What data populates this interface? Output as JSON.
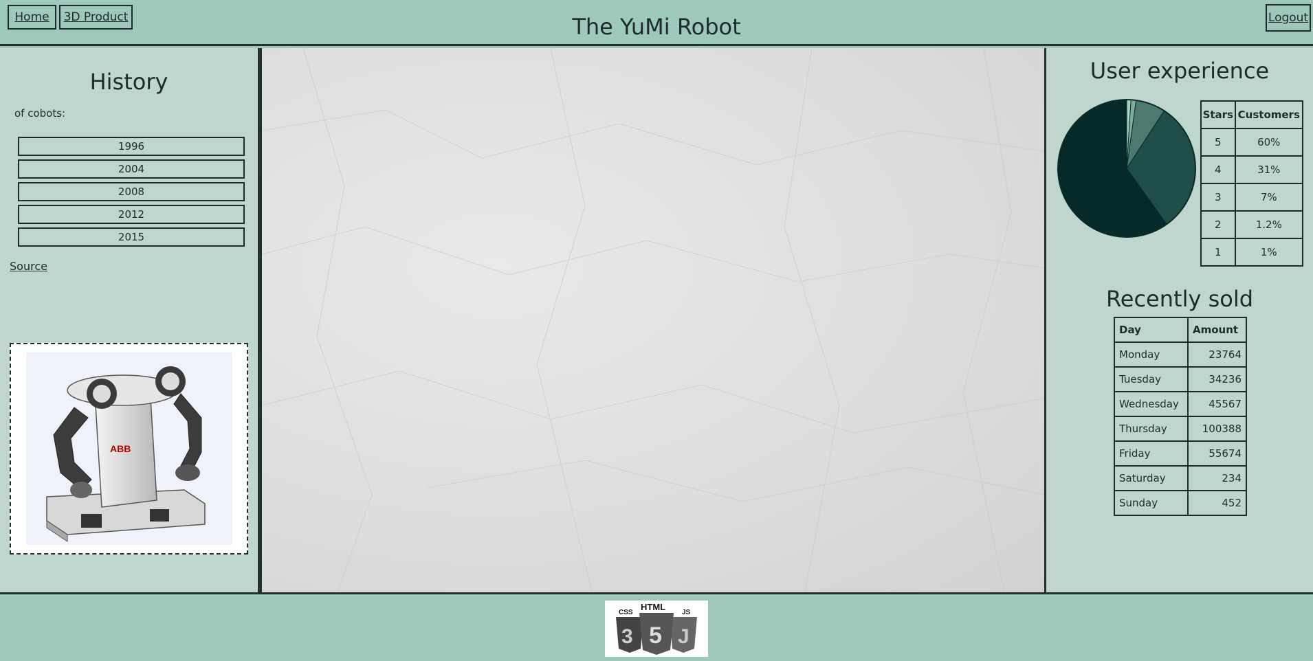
{
  "header": {
    "title": "The YuMi Robot",
    "nav": {
      "home": "Home",
      "product": "3D Product",
      "logout": "Logout"
    }
  },
  "history": {
    "title": "History",
    "subtitle": "of cobots:",
    "years": [
      "1996",
      "2004",
      "2008",
      "2012",
      "2015"
    ],
    "source_label": "Source",
    "image_icon": "yumi-robot-image",
    "robot_brand": "ABB"
  },
  "user_experience": {
    "title": "User experience",
    "headers": {
      "stars": "Stars",
      "customers": "Customers"
    },
    "rows": [
      {
        "stars": "5",
        "customers": "60%"
      },
      {
        "stars": "4",
        "customers": "31%"
      },
      {
        "stars": "3",
        "customers": "7%"
      },
      {
        "stars": "2",
        "customers": "1.2%"
      },
      {
        "stars": "1",
        "customers": "1%"
      }
    ]
  },
  "chart_data": {
    "type": "pie",
    "categories": [
      "5",
      "4",
      "3",
      "2",
      "1"
    ],
    "values": [
      60,
      31,
      7,
      1.2,
      1
    ],
    "colors": [
      "#06292a",
      "#1e4d4a",
      "#4d7a70",
      "#7fae9f",
      "#a6d2c3"
    ]
  },
  "recently_sold": {
    "title": "Recently sold",
    "headers": {
      "day": "Day",
      "amount": "Amount"
    },
    "rows": [
      {
        "day": "Monday",
        "amount": "23764"
      },
      {
        "day": "Tuesday",
        "amount": "34236"
      },
      {
        "day": "Wednesday",
        "amount": "45567"
      },
      {
        "day": "Thursday",
        "amount": "100388"
      },
      {
        "day": "Friday",
        "amount": "55674"
      },
      {
        "day": "Saturday",
        "amount": "234"
      },
      {
        "day": "Sunday",
        "amount": "452"
      }
    ]
  },
  "footer": {
    "logo_html": "HTML",
    "logo_css": "CSS",
    "logo_js": "JS",
    "logo_icon": "html5-css3-js-logo"
  }
}
